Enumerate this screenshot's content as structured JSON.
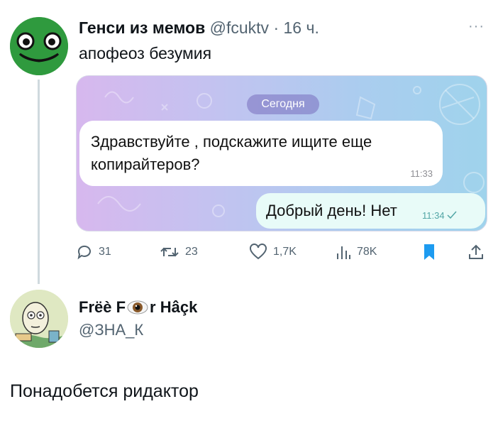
{
  "tweet": {
    "author_name": "Генси из мемов",
    "author_handle": "@fcuktv",
    "separator": "·",
    "time": "16 ч.",
    "more": "···",
    "text": "апофеоз безумия",
    "media": {
      "date_pill": "Сегодня",
      "incoming_message": "Здравствуйте , подскажите ищите еще копирайтеров?",
      "incoming_time": "11:33",
      "outgoing_message": "Добрый день! Нет",
      "outgoing_time": "11:34"
    },
    "actions": {
      "replies": "31",
      "retweets": "23",
      "likes": "1,7K",
      "views": "78K"
    }
  },
  "reply": {
    "name_part1": "Frëè F",
    "name_part2": "r Hâçk",
    "handle": "@ЗНА_К",
    "text": "Понадобется ридактор"
  },
  "colors": {
    "accent": "#1d9bf0",
    "muted": "#536471",
    "avatar_green": "#2f9a3e"
  }
}
